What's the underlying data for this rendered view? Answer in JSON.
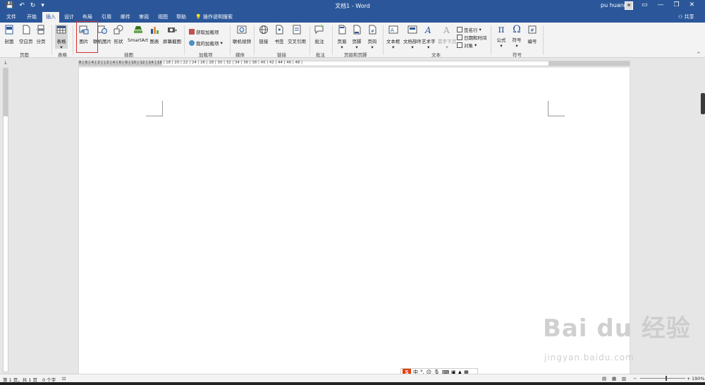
{
  "titlebar": {
    "doc_title": "文档1  -  Word",
    "user_name": "pu huang",
    "restore_glyph": "▭",
    "minimize_glyph": "—",
    "maximize_glyph": "❐",
    "close_glyph": "✕"
  },
  "tabs": [
    "文件",
    "开始",
    "插入",
    "设计",
    "布局",
    "引用",
    "邮件",
    "审阅",
    "视图",
    "帮助"
  ],
  "active_tab": "插入",
  "tellme": "操作说明搜索",
  "share": "共享",
  "ribbon": {
    "cover": "封面",
    "blank_page": "空白页",
    "page_break": "分页",
    "group_pages": "页面",
    "table": "表格",
    "group_table": "表格",
    "picture": "图片",
    "online_picture": "联机图片",
    "shapes": "形状",
    "smartart": "SmartArt",
    "chart": "图表",
    "screenshot": "屏幕截图",
    "group_illustrations": "插图",
    "get_addins": "获取加载项",
    "my_addins": "我的加载项",
    "group_addins": "加载项",
    "online_video": "联机视频",
    "group_media": "媒体",
    "link": "链接",
    "bookmark": "书签",
    "cross_reference": "交叉引用",
    "group_links": "链接",
    "comment": "批注",
    "group_comments": "批注",
    "header": "页眉",
    "footer": "页脚",
    "page_number": "页码",
    "group_header_footer": "页眉和页脚",
    "textbox": "文本框",
    "quick_parts": "文档部件",
    "wordart": "艺术字",
    "drop_cap": "首字下沉",
    "signature_line": "签名行",
    "date_time": "日期和时间",
    "object": "对象",
    "group_text": "文本",
    "equation": "公式",
    "symbol": "符号",
    "number": "编号",
    "group_symbols": "符号"
  },
  "ruler_numbers": "8 | 6 | 4 | 2 |   | 2 | 4 | 6 | 8 | 10 | 12 | 14 | 16 | 18 | 20 | 22 | 24 | 26 | 28 | 30 | 32 | 34 | 36 | 38 | 40 | 42 | 44 | 46 | 48 |",
  "statusbar": {
    "page_info": "第 1 页，共 1 页",
    "word_count": "0 个字",
    "zoom": "190%"
  },
  "ime": {
    "logo": "S",
    "mode": "中"
  },
  "watermark": {
    "line1": "Bai du 经验",
    "line2": "jingyan.baidu.com"
  },
  "colors": {
    "accent": "#2b579a",
    "highlight": "#d32f2f"
  }
}
